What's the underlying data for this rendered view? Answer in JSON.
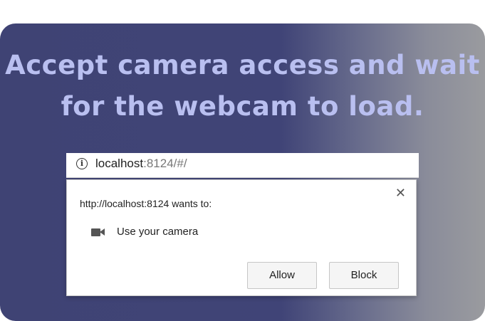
{
  "headline": {
    "line1": "Accept camera access and wait",
    "line2": "for the webcam to load."
  },
  "browser": {
    "url_host": "localhost",
    "url_rest": ":8124/#/",
    "info_icon": "info-icon"
  },
  "permission_dialog": {
    "close_glyph": "✕",
    "prompt": "http://localhost:8124 wants to:",
    "permission_icon": "video-camera-icon",
    "permission_label": "Use your camera",
    "allow_label": "Allow",
    "block_label": "Block"
  },
  "colors": {
    "card_start": "#3f4374",
    "card_end": "#9a9b9f",
    "headline_text": "#b9bff0"
  }
}
